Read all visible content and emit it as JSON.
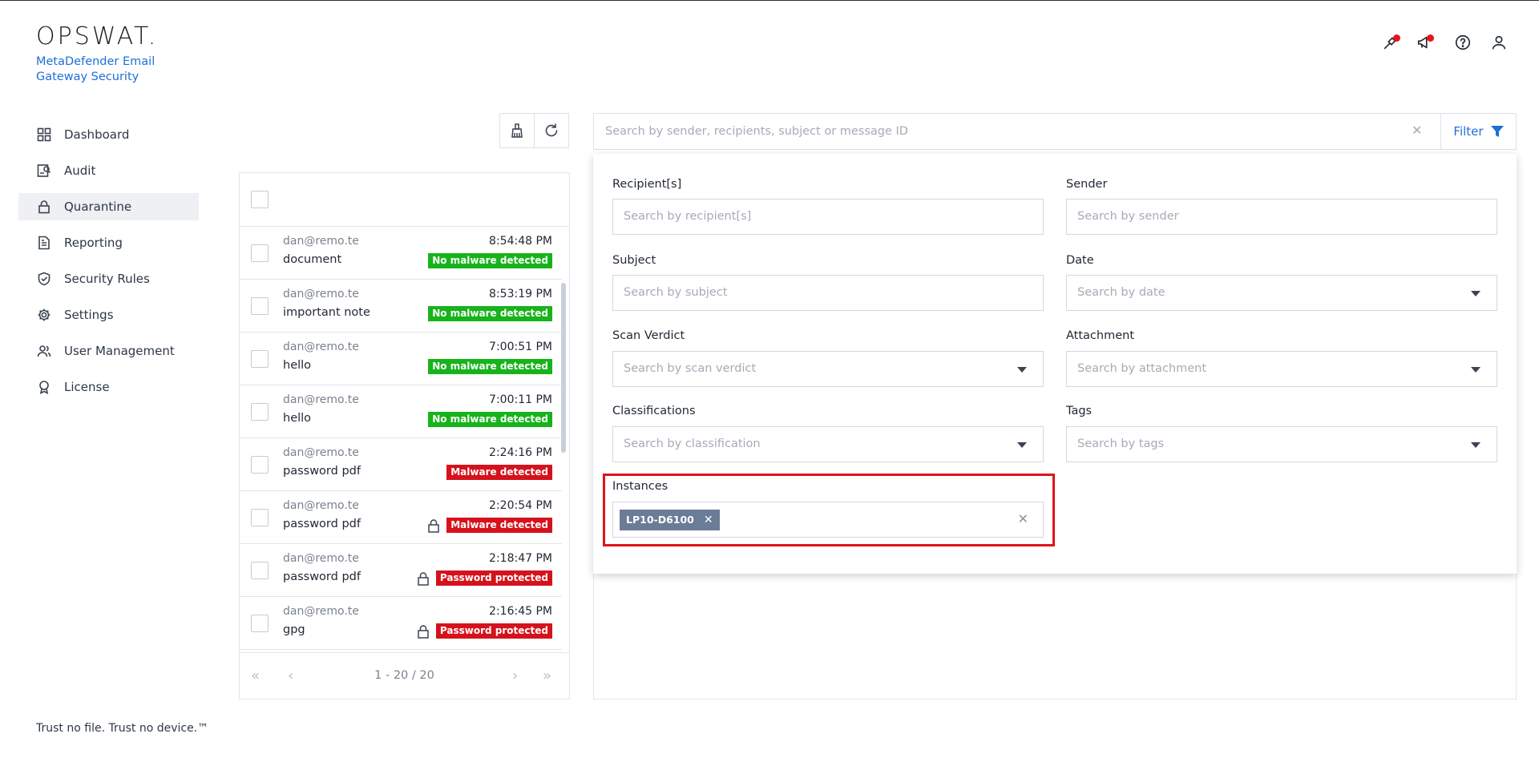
{
  "brand": {
    "logo": "OPSWAT.",
    "product": "MetaDefender Email Gateway Security",
    "tagline": "Trust no file. Trust no device.™"
  },
  "header": {
    "icons": [
      "tools-icon",
      "announcement-icon",
      "help-icon",
      "user-icon"
    ]
  },
  "sidebar": {
    "items": [
      {
        "label": "Dashboard",
        "icon": "dashboard-icon"
      },
      {
        "label": "Audit",
        "icon": "audit-icon"
      },
      {
        "label": "Quarantine",
        "icon": "lock-icon",
        "active": true
      },
      {
        "label": "Reporting",
        "icon": "document-icon"
      },
      {
        "label": "Security Rules",
        "icon": "shield-check-icon"
      },
      {
        "label": "Settings",
        "icon": "gear-icon"
      },
      {
        "label": "User Management",
        "icon": "users-icon"
      },
      {
        "label": "License",
        "icon": "award-icon"
      }
    ]
  },
  "list": {
    "rows": [
      {
        "sender": "dan@remo.te",
        "subject": "document",
        "time": "8:54:48 PM",
        "badge": "No malware detected",
        "status": "green",
        "locked": false
      },
      {
        "sender": "dan@remo.te",
        "subject": "important note",
        "time": "8:53:19 PM",
        "badge": "No malware detected",
        "status": "green",
        "locked": false
      },
      {
        "sender": "dan@remo.te",
        "subject": "hello",
        "time": "7:00:51 PM",
        "badge": "No malware detected",
        "status": "green",
        "locked": false
      },
      {
        "sender": "dan@remo.te",
        "subject": "hello",
        "time": "7:00:11 PM",
        "badge": "No malware detected",
        "status": "green",
        "locked": false
      },
      {
        "sender": "dan@remo.te",
        "subject": "password pdf",
        "time": "2:24:16 PM",
        "badge": "Malware detected",
        "status": "red",
        "locked": false
      },
      {
        "sender": "dan@remo.te",
        "subject": "password pdf",
        "time": "2:20:54 PM",
        "badge": "Malware detected",
        "status": "red",
        "locked": true
      },
      {
        "sender": "dan@remo.te",
        "subject": "password pdf",
        "time": "2:18:47 PM",
        "badge": "Password protected",
        "status": "red",
        "locked": true
      },
      {
        "sender": "dan@remo.te",
        "subject": "gpg",
        "time": "2:16:45 PM",
        "badge": "Password protected",
        "status": "red",
        "locked": true
      }
    ],
    "pagination": "1 - 20 / 20"
  },
  "search": {
    "placeholder": "Search by sender, recipients, subject or message ID",
    "clear": "✕",
    "filter_label": "Filter"
  },
  "filters": {
    "recipients": {
      "label": "Recipient[s]",
      "placeholder": "Search by recipient[s]"
    },
    "sender": {
      "label": "Sender",
      "placeholder": "Search by sender"
    },
    "subject": {
      "label": "Subject",
      "placeholder": "Search by subject"
    },
    "date": {
      "label": "Date",
      "placeholder": "Search by date"
    },
    "scan_verdict": {
      "label": "Scan Verdict",
      "placeholder": "Search by scan verdict"
    },
    "attachment": {
      "label": "Attachment",
      "placeholder": "Search by attachment"
    },
    "classifications": {
      "label": "Classifications",
      "placeholder": "Search by classification"
    },
    "tags": {
      "label": "Tags",
      "placeholder": "Search by tags"
    },
    "instances": {
      "label": "Instances",
      "chip": "LP10-D6100",
      "chip_remove": "✕",
      "clear": "✕"
    }
  },
  "colors": {
    "accent": "#1d6fd8",
    "green_badge": "#17b31b",
    "red_badge": "#d5121c",
    "highlight": "#e0121c"
  }
}
